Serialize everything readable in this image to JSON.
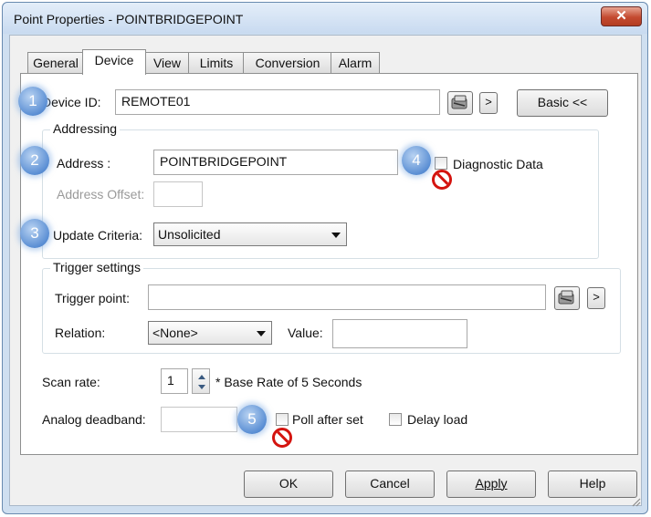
{
  "window": {
    "title": "Point Properties - POINTBRIDGEPOINT",
    "close_label": "✕"
  },
  "tabs": [
    {
      "label": "General"
    },
    {
      "label": "Device",
      "active": true
    },
    {
      "label": "View"
    },
    {
      "label": "Limits"
    },
    {
      "label": "Conversion"
    },
    {
      "label": "Alarm"
    }
  ],
  "device": {
    "id_label": "Device ID:",
    "id_value": "REMOTE01",
    "arrow_label": ">",
    "basic_label": "Basic <<"
  },
  "addressing": {
    "legend": "Addressing",
    "address_label": "Address :",
    "address_value": "POINTBRIDGEPOINT",
    "offset_label": "Address Offset:",
    "offset_value": "",
    "diagnostic_label": "Diagnostic Data",
    "update_label": "Update Criteria:",
    "update_value": "Unsolicited"
  },
  "trigger": {
    "legend": "Trigger settings",
    "point_label": "Trigger point:",
    "point_value": "",
    "arrow_label": ">",
    "relation_label": "Relation:",
    "relation_value": "<None>",
    "value_label": "Value:",
    "value_value": ""
  },
  "scan": {
    "rate_label": "Scan rate:",
    "rate_value": "1",
    "rate_note": "* Base Rate of 5 Seconds",
    "deadband_label": "Analog deadband:",
    "deadband_value": "",
    "poll_label": "Poll after set",
    "delay_label": "Delay load"
  },
  "callouts": [
    "1",
    "2",
    "3",
    "4",
    "5"
  ],
  "buttons": {
    "ok": "OK",
    "cancel": "Cancel",
    "apply": "Apply",
    "help": "Help"
  },
  "colors": {
    "callout": "#5b8fd4",
    "prohibited": "#d4140f",
    "close": "#c44a30"
  }
}
